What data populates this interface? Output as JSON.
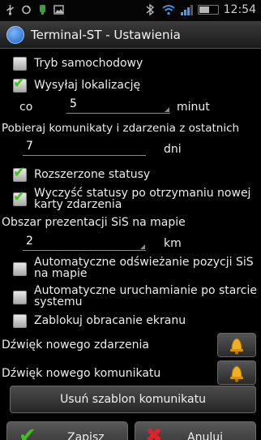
{
  "status_bar": {
    "time": "12:54",
    "battery_level": 0.55
  },
  "title_bar": {
    "title": "Terminal-ST - Ustawienia"
  },
  "settings": {
    "car_mode": {
      "label": "Tryb samochodowy",
      "checked": false
    },
    "send_location": {
      "label": "Wysyłaj lokalizację",
      "checked": true
    },
    "interval": {
      "prefix": "co",
      "value": "5",
      "unit": "minut"
    },
    "fetch_label": "Pobieraj komunikaty i zdarzenia z ostatnich",
    "fetch_days": {
      "value": "7",
      "unit": "dni"
    },
    "extended_statuses": {
      "label": "Rozszerzone statusy",
      "checked": true
    },
    "clear_statuses": {
      "label": "Wyczyść statusy po otrzymaniu nowej karty zdarzenia",
      "checked": true
    },
    "area_label": "Obszar prezentacji SiS na mapie",
    "area_km": {
      "value": "2",
      "unit": "km"
    },
    "auto_refresh": {
      "label": "Automatyczne odświeżanie pozycji SiS na mapie",
      "checked": false
    },
    "auto_start": {
      "label": "Automatyczne uruchamianie po starcie systemu",
      "checked": false
    },
    "lock_rotation": {
      "label": "Zablokuj obracanie ekranu",
      "checked": false
    },
    "new_event_sound": {
      "label": "Dźwięk nowego zdarzenia",
      "icon": "bell-icon"
    },
    "new_message_sound": {
      "label": "Dźwięk nowego komunikatu",
      "icon": "bell-icon"
    },
    "remove_template": {
      "label": "Usuń szablon komunikatu"
    }
  },
  "bottom_bar": {
    "save": {
      "label": "Zapisz",
      "icon": "checkmark-icon",
      "color": "#3fc21a"
    },
    "cancel": {
      "label": "Anuluj",
      "icon": "cross-icon",
      "color": "#e0202a"
    }
  }
}
